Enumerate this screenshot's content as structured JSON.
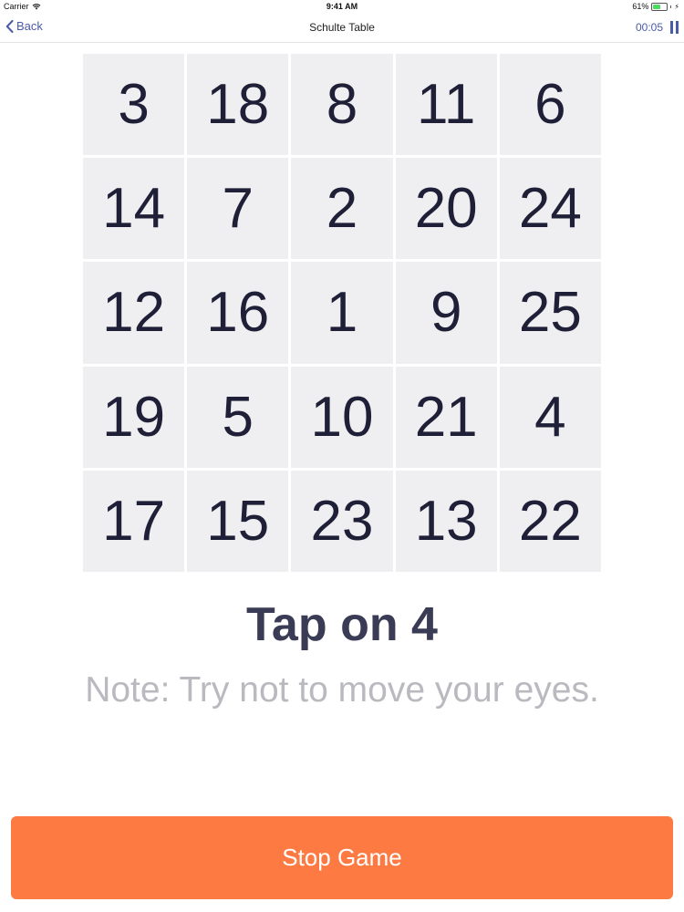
{
  "status_bar": {
    "carrier": "Carrier",
    "time": "9:41 AM",
    "battery_percent": "61%",
    "battery_level": 0.61
  },
  "nav": {
    "back_label": "Back",
    "title": "Schulte Table",
    "timer": "00:05"
  },
  "grid": {
    "cells": [
      "3",
      "18",
      "8",
      "11",
      "6",
      "14",
      "7",
      "2",
      "20",
      "24",
      "12",
      "16",
      "1",
      "9",
      "25",
      "19",
      "5",
      "10",
      "21",
      "4",
      "17",
      "15",
      "23",
      "13",
      "22"
    ]
  },
  "prompt": "Tap on 4",
  "note": "Note: Try not to move your eyes.",
  "stop_button_label": "Stop Game",
  "colors": {
    "accent": "#4a5ba8",
    "stop_button": "#fe7a43",
    "cell_bg": "#efeff1",
    "prompt_text": "#3a3b55",
    "note_text": "#b9b9bf"
  }
}
